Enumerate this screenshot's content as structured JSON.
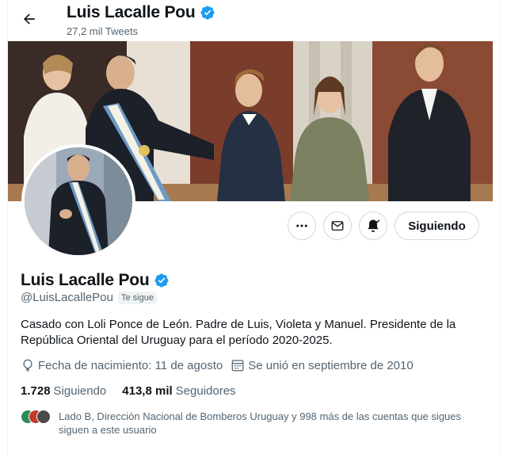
{
  "header": {
    "name": "Luis Lacalle Pou",
    "tweet_count": "27,2 mil Tweets"
  },
  "profile": {
    "name": "Luis Lacalle Pou",
    "handle": "@LuisLacallePou",
    "follows_you": "Te sigue",
    "bio": "Casado con Loli Ponce de León. Padre de Luis, Violeta y Manuel. Presidente de la República Oriental del Uruguay para el período 2020-2025.",
    "birthdate": "Fecha de nacimiento: 11 de agosto",
    "joined": "Se unió en septiembre de 2010",
    "following_count": "1.728",
    "following_label": "Siguiendo",
    "followers_count": "413,8 mil",
    "followers_label": "Seguidores",
    "mutual_followers": "Lado B, Dirección Nacional de Bomberos Uruguay y 998 más de las cuentas que sigues siguen a este usuario"
  },
  "actions": {
    "following_button": "Siguiendo"
  },
  "icons": {
    "back": "arrow-left-icon",
    "verified": "verified-badge-icon",
    "more": "more-icon",
    "message": "envelope-icon",
    "notifications": "bell-icon",
    "birthday": "balloon-icon",
    "joined": "calendar-icon"
  },
  "colors": {
    "verified": "#1d9bf0",
    "text": "#0f1419",
    "secondary_text": "#536471",
    "border": "#cfd9de"
  }
}
